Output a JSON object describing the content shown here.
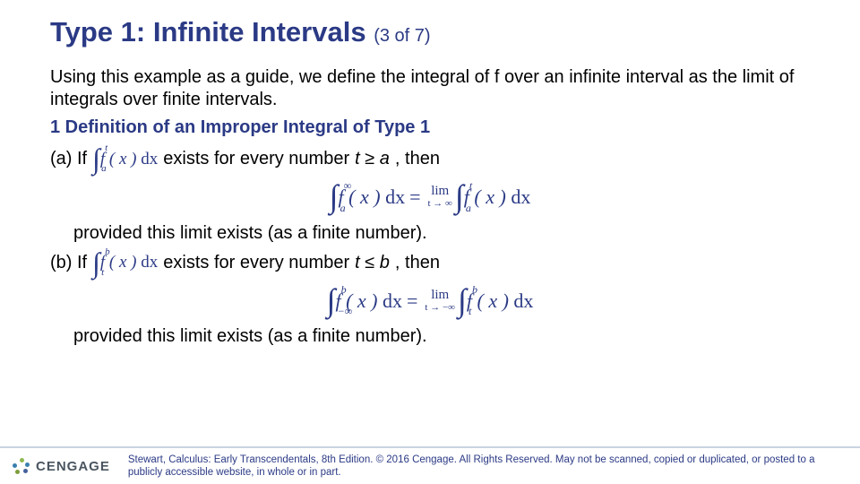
{
  "title": "Type 1: Infinite Intervals",
  "pageIndicator": "(3 of 7)",
  "intro": "Using this example as a guide, we define the integral of f over an infinite interval as the limit of integrals over finite intervals.",
  "defHeading": "1 Definition of an Improper Integral of Type 1",
  "a": {
    "prefix": "(a) If",
    "inline": {
      "lower": "a",
      "upper": "t",
      "expr": "f ( x )",
      "diff": "dx"
    },
    "suffix1": "exists for every number ",
    "suffix2": "t ≥ a",
    "suffix3": ", then",
    "block": {
      "left": {
        "lower": "a",
        "upper": "∞",
        "expr": "f ( x )",
        "diff": "dx"
      },
      "lim": {
        "word": "lim",
        "under": "t → ∞"
      },
      "right": {
        "lower": "a",
        "upper": "t",
        "expr": "f ( x )",
        "diff": "dx"
      }
    },
    "provided": "provided this limit exists (as a finite number)."
  },
  "b": {
    "prefix": "(b) If",
    "inline": {
      "lower": "t",
      "upper": "b",
      "expr": "f ( x )",
      "diff": "dx"
    },
    "suffix1": "exists for every number ",
    "suffix2": "t ≤ b",
    "suffix3": ", then",
    "block": {
      "left": {
        "lower": "−∞",
        "upper": "b",
        "expr": "f ( x )",
        "diff": "dx"
      },
      "lim": {
        "word": "lim",
        "under": "t → −∞"
      },
      "right": {
        "lower": "t",
        "upper": "b",
        "expr": "f ( x )",
        "diff": "dx"
      }
    },
    "provided": "provided this limit exists (as a finite number)."
  },
  "footer": {
    "brand": "CENGAGE",
    "copyright": "Stewart, Calculus: Early Transcendentals, 8th Edition. © 2016 Cengage. All Rights Reserved. May not be scanned, copied or duplicated, or posted to a publicly accessible website, in whole or in part."
  }
}
